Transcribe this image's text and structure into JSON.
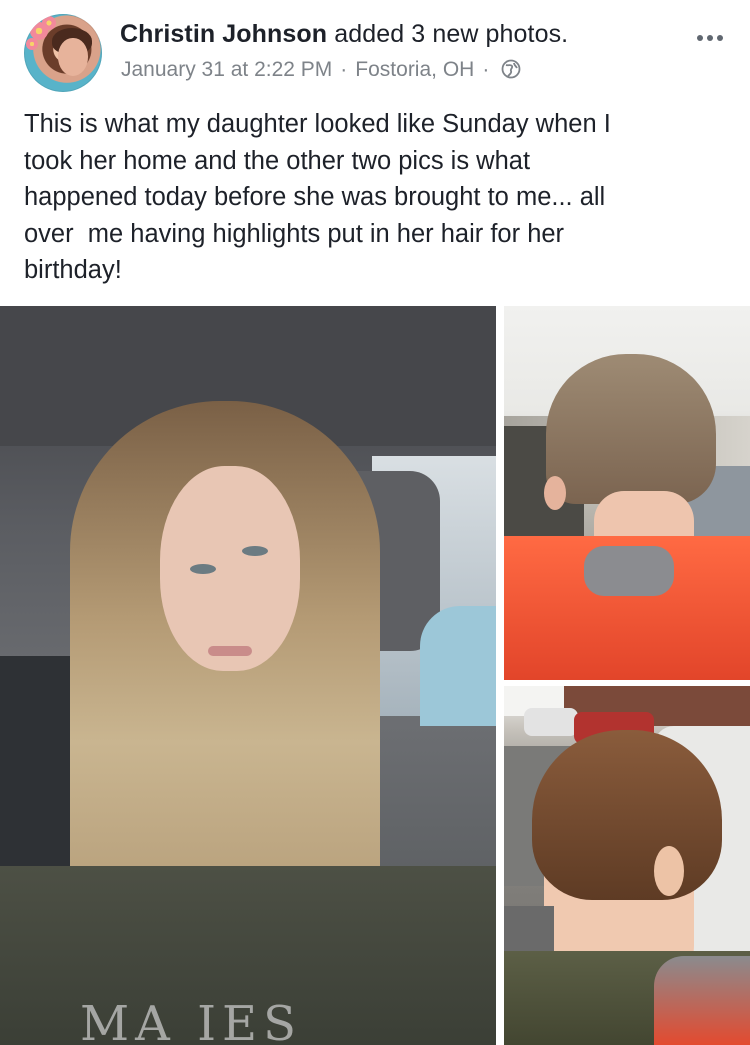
{
  "post": {
    "author_name": "Christin Johnson",
    "action_text": " added 3 new photos.",
    "timestamp": "January 31 at 2:22 PM",
    "separator": "·",
    "location": "Fostoria, OH",
    "privacy_icon": "globe-icon",
    "more_icon": "more-options-icon",
    "text": "This is what my daughter looked like Sunday when I\ntook her home and the other two pics is what\nhappened today before she was brought to me... all\nover  me having highlights put in her hair for her\nbirthday!"
  },
  "photos": {
    "count": 3,
    "main_hoodie_text": "MA  IES"
  },
  "colors": {
    "text_primary": "#1d2129",
    "text_secondary": "#7e8389",
    "icon_gray": "#606770",
    "background": "#ffffff"
  }
}
